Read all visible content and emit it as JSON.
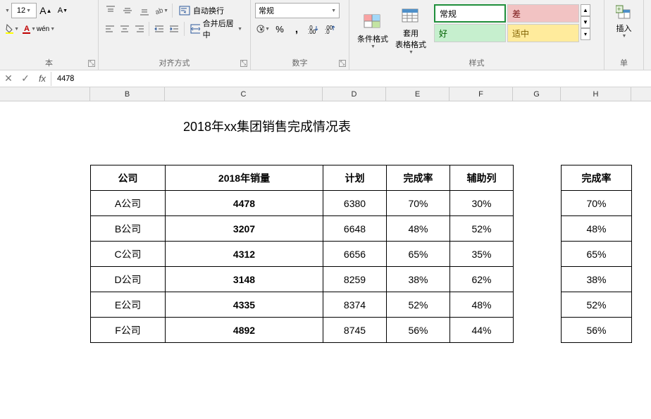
{
  "ribbon": {
    "font": {
      "size": "12",
      "larger": "A",
      "smaller": "A",
      "group_label": "本"
    },
    "alignment": {
      "wrap": "自动换行",
      "merge": "合并后居中",
      "group_label": "对齐方式"
    },
    "number": {
      "format": "常规",
      "group_label": "数字"
    },
    "styles": {
      "conditional": "条件格式",
      "table_format": "套用\n表格格式",
      "normal": "常规",
      "bad": "差",
      "good": "好",
      "neutral": "适中",
      "group_label": "样式"
    },
    "cells": {
      "insert": "插入",
      "group_label": "单"
    }
  },
  "formula_bar": {
    "value": "4478"
  },
  "columns": [
    "B",
    "C",
    "D",
    "E",
    "F",
    "G",
    "H"
  ],
  "sheet": {
    "title": "2018年xx集团销售完成情况表",
    "headers": {
      "company": "公司",
      "sales": "2018年销量",
      "plan": "计划",
      "rate": "完成率",
      "aux": "辅助列"
    },
    "rows": [
      {
        "company": "A公司",
        "sales": "4478",
        "plan": "6380",
        "rate": "70%",
        "aux": "30%"
      },
      {
        "company": "B公司",
        "sales": "3207",
        "plan": "6648",
        "rate": "48%",
        "aux": "52%"
      },
      {
        "company": "C公司",
        "sales": "4312",
        "plan": "6656",
        "rate": "65%",
        "aux": "35%"
      },
      {
        "company": "D公司",
        "sales": "3148",
        "plan": "8259",
        "rate": "38%",
        "aux": "62%"
      },
      {
        "company": "E公司",
        "sales": "4335",
        "plan": "8374",
        "rate": "52%",
        "aux": "48%"
      },
      {
        "company": "F公司",
        "sales": "4892",
        "plan": "8745",
        "rate": "56%",
        "aux": "44%"
      }
    ],
    "side_header": "完成率",
    "side_rows": [
      "70%",
      "48%",
      "65%",
      "38%",
      "52%",
      "56%"
    ]
  }
}
